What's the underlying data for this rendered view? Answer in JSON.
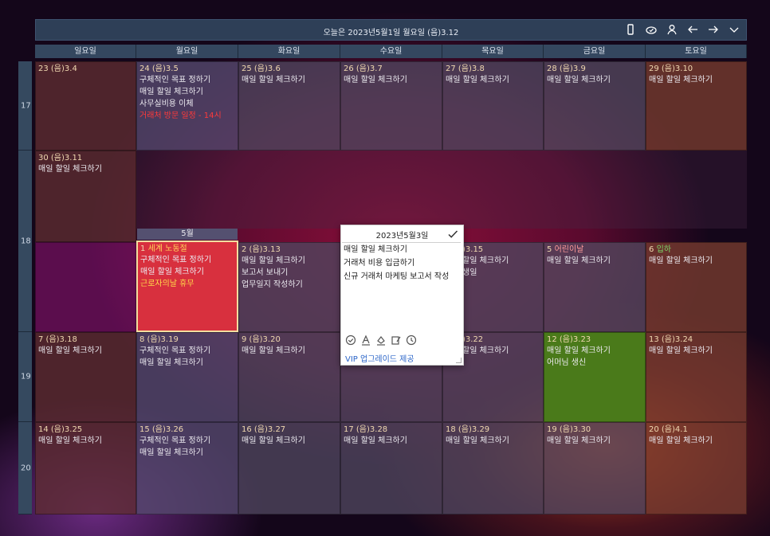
{
  "header": {
    "title": "오늘은 2023년5월1일 월요일 (음)3.12",
    "icons": [
      "phone-icon",
      "cloud-sync-icon",
      "user-icon",
      "arrow-left-icon",
      "arrow-right-icon",
      "chevron-down-icon"
    ]
  },
  "days_of_week": [
    "일요일",
    "월요일",
    "화요일",
    "수요일",
    "목요일",
    "금요일",
    "토요일"
  ],
  "weeks": [
    "17",
    "18",
    "19",
    "20"
  ],
  "month_label": "5월",
  "cells": {
    "w17": [
      {
        "date": "23 (음)3.4",
        "events": []
      },
      {
        "date": "24 (음)3.5",
        "events": [
          "구체적인 목표 정하기",
          "매일 할일 체크하기",
          "사무실비용 이체",
          "거래처 방문 일정 - 14시"
        ]
      },
      {
        "date": "25 (음)3.6",
        "events": [
          "매일 할일 체크하기"
        ]
      },
      {
        "date": "26 (음)3.7",
        "events": [
          "매일 할일 체크하기"
        ]
      },
      {
        "date": "27 (음)3.8",
        "events": [
          "매일 할일 체크하기"
        ]
      },
      {
        "date": "28 (음)3.9",
        "events": [
          "매일 할일 체크하기"
        ]
      },
      {
        "date": "29 (음)3.10",
        "events": [
          "매일 할일 체크하기"
        ]
      }
    ],
    "w18a": {
      "date": "30 (음)3.11",
      "events": [
        "매일 할일 체크하기"
      ]
    },
    "w18b": [
      {
        "date": "1",
        "holiday": "세계 노동절",
        "events": [
          "구체적인 목표 정하기",
          "매일 할일 체크하기",
          "근로자의날 휴무"
        ]
      },
      {
        "date": "2 (음)3.13",
        "events": [
          "매일 할일 체크하기",
          "보고서 보내기",
          "업무일지 작성하기"
        ]
      },
      {
        "date": ")3.15",
        "events": [
          "할일 체크하기",
          "생일"
        ]
      },
      {
        "date": "5",
        "holiday": "어린이날",
        "events": [
          "매일 할일 체크하기"
        ]
      },
      {
        "date": "6",
        "holiday": "입하",
        "events": [
          "매일 할일 체크하기"
        ]
      }
    ],
    "w19": [
      {
        "date": "7 (음)3.18",
        "events": [
          "매일 할일 체크하기"
        ]
      },
      {
        "date": "8 (음)3.19",
        "events": [
          "구체적인 목표 정하기",
          "매일 할일 체크하기"
        ]
      },
      {
        "date": "9 (음)3.20",
        "events": [
          "매일 할일 체크하기"
        ]
      },
      {
        "date": "",
        "events": []
      },
      {
        "date": ")3.22",
        "events": [
          "할일 체크하기"
        ]
      },
      {
        "date": "12 (음)3.23",
        "events": [
          "매일 할일 체크하기",
          "어머님 생신"
        ]
      },
      {
        "date": "13 (음)3.24",
        "events": [
          "매일 할일 체크하기"
        ]
      }
    ],
    "w20": [
      {
        "date": "14 (음)3.25",
        "events": [
          "매일 할일 체크하기"
        ]
      },
      {
        "date": "15 (음)3.26",
        "events": [
          "구체적인 목표 정하기",
          "매일 할일 체크하기"
        ]
      },
      {
        "date": "16 (음)3.27",
        "events": [
          "매일 할일 체크하기"
        ]
      },
      {
        "date": "17 (음)3.28",
        "events": [
          "매일 할일 체크하기"
        ]
      },
      {
        "date": "18 (음)3.29",
        "events": [
          "매일 할일 체크하기"
        ]
      },
      {
        "date": "19 (음)3.30",
        "events": [
          "매일 할일 체크하기"
        ]
      },
      {
        "date": "20 (음)4.1",
        "events": [
          "매일 할일 체크하기"
        ]
      }
    ]
  },
  "popup": {
    "title": "2023년5월3일",
    "lines": [
      "매일 할일 체크하기",
      "거래처 비용 입금하기",
      "신규 거래처 마케팅 보고서 작성"
    ],
    "tools": [
      "check-circle-icon",
      "text-color-icon",
      "fill-color-icon",
      "edit-note-icon",
      "clock-icon"
    ],
    "vip": "VIP 업그레이드 제공"
  },
  "colors": {
    "selected": "#d8303e",
    "green": "#4a7a1a",
    "header": "#2e3f57",
    "red_event": "#ff3a3a",
    "holiday": "#ffd45a"
  }
}
